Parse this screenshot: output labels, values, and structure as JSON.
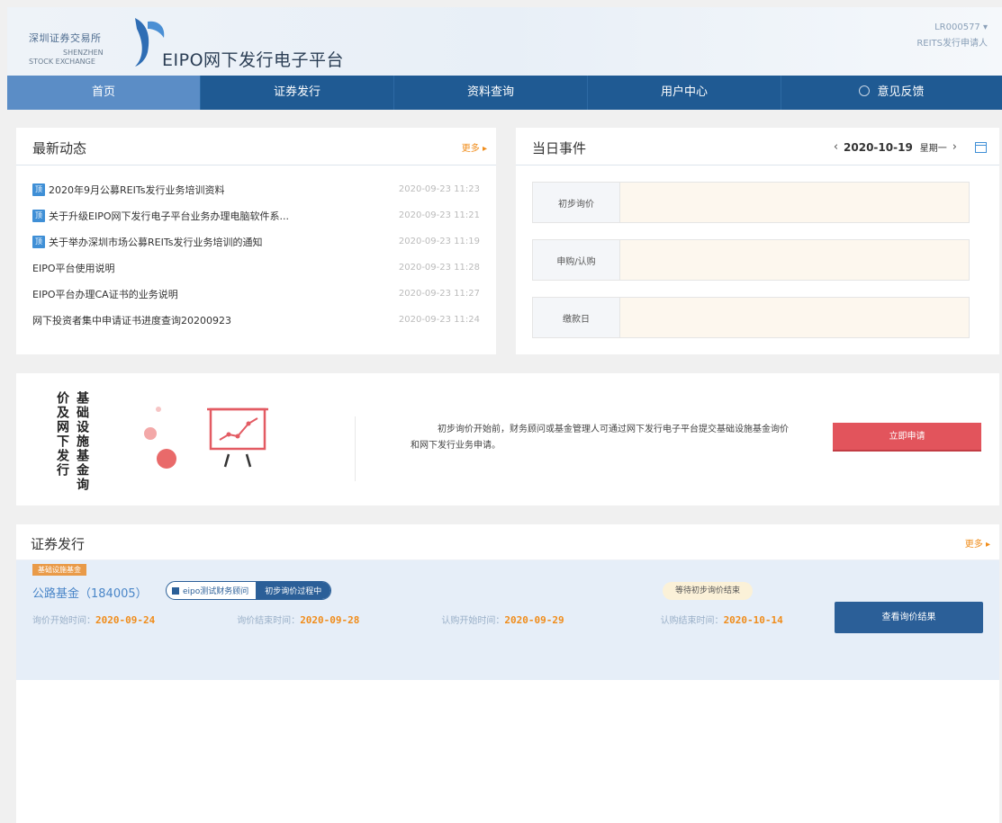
{
  "header": {
    "logo_cn": "深圳证券交易所",
    "logo_en_line1": "SHENZHEN",
    "logo_en_line2": "STOCK EXCHANGE",
    "platform_title": "EIPO网下发行电子平台",
    "user_id": "LR000577 ▾",
    "user_role": "REITS发行申请人"
  },
  "nav": {
    "items": [
      {
        "label": "首页",
        "active": true
      },
      {
        "label": "证券发行"
      },
      {
        "label": "资料查询"
      },
      {
        "label": "用户中心"
      },
      {
        "label": "意见反馈",
        "icon": "help-circle-icon"
      }
    ]
  },
  "news": {
    "title": "最新动态",
    "more": "更多 ▸",
    "top_badge": "顶",
    "items": [
      {
        "title": "2020年9月公募REITs发行业务培训资料",
        "time": "2020-09-23 11:23",
        "pinned": true
      },
      {
        "title": "关于升级EIPO网下发行电子平台业务办理电脑软件系...",
        "time": "2020-09-23 11:21",
        "pinned": true
      },
      {
        "title": "关于举办深圳市场公募REITs发行业务培训的通知",
        "time": "2020-09-23 11:19",
        "pinned": true
      },
      {
        "title": "EIPO平台使用说明",
        "time": "2020-09-23 11:28",
        "pinned": false
      },
      {
        "title": "EIPO平台办理CA证书的业务说明",
        "time": "2020-09-23 11:27",
        "pinned": false
      },
      {
        "title": "网下投资者集中申请证书进度查询20200923",
        "time": "2020-09-23 11:24",
        "pinned": false
      }
    ]
  },
  "events": {
    "title": "当日事件",
    "prev": "‹",
    "date": "2020-10-19",
    "weekday": "星期一",
    "next": "›",
    "rows": [
      {
        "label": "初步询价"
      },
      {
        "label": "申购/认购"
      },
      {
        "label": "缴款日"
      }
    ]
  },
  "banner": {
    "title": "基础设施基金询价及网下发行",
    "description": "初步询价开始前，财务顾问或基金管理人可通过网下发行电子平台提交基础设施基金询价和网下发行业务申请。",
    "button": "立即申请"
  },
  "securities": {
    "title": "证券发行",
    "more": "更多 ▸",
    "card": {
      "tag": "基础设施基金",
      "fund_name": "公路基金（184005）",
      "advisor": "eipo测试财务顾问",
      "stage": "初步询价过程中",
      "status": "等待初步询价结束",
      "view_button": "查看询价结果",
      "dates": [
        {
          "key": "询价开始时间：",
          "value": "2020-09-24"
        },
        {
          "key": "询价结束时间：",
          "value": "2020-09-28"
        },
        {
          "key": "认购开始时间：",
          "value": "2020-09-29"
        },
        {
          "key": "认购结束时间：",
          "value": "2020-10-14"
        }
      ]
    }
  },
  "colors": {
    "nav_bg": "#1f5a93",
    "nav_active": "#5b8dc6",
    "accent_orange": "#f08c1a",
    "apply_red": "#e2545c",
    "primary_blue": "#2b5f98"
  }
}
